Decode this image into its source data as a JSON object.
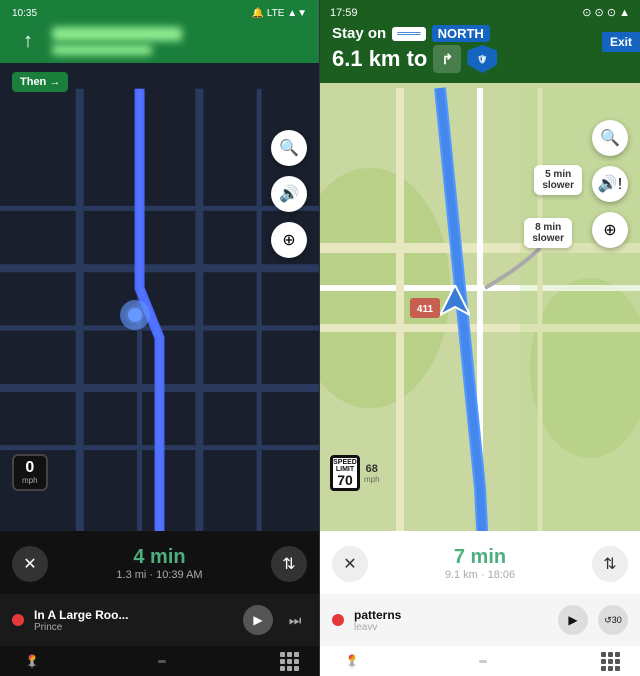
{
  "left": {
    "status_bar": {
      "time": "10:35",
      "icons": "🔔 ⊗ LTE▲▼"
    },
    "header": {
      "arrow": "↑",
      "street_blurred": true,
      "then_label": "Then →"
    },
    "speed": {
      "value": "0",
      "unit": "mph"
    },
    "nav_bar": {
      "close_btn": "✕",
      "time_label": "4 min",
      "details": "1.3 mi · 10:39 AM",
      "route_btn": "⇅"
    },
    "music": {
      "title": "In A Large Roo...",
      "artist": "Prince",
      "play_btn": "▶",
      "skip_btn": "⏭"
    },
    "buttons": {
      "search": "🔍",
      "sound": "🔊",
      "plus": "⊕"
    }
  },
  "right": {
    "status_bar": {
      "time": "17:59",
      "icons": "⊙ ⊙ ⊙ ▲"
    },
    "header": {
      "stay_on": "Stay on",
      "highway": "═══",
      "direction": "NORTH",
      "distance": "6.1 km to",
      "turn_icon": "↱",
      "exit_badge": "Exit"
    },
    "traffic": {
      "bubble1_line1": "5 min",
      "bubble1_line2": "slower",
      "bubble2_line1": "8 min",
      "bubble2_line2": "slower",
      "route_num": "411"
    },
    "speed_limit": {
      "limit": "70",
      "current": "68",
      "unit": "mph"
    },
    "nav_bar": {
      "close_btn": "✕",
      "time_label": "7 min",
      "details": "9.1 km · 18:06",
      "route_btn": "⇅"
    },
    "music": {
      "title": "patterns",
      "artist": "leavv",
      "play_btn": "▶",
      "replay_btn": "↺30"
    },
    "buttons": {
      "search": "🔍",
      "sound": "🔊!",
      "plus": "⊕"
    }
  }
}
